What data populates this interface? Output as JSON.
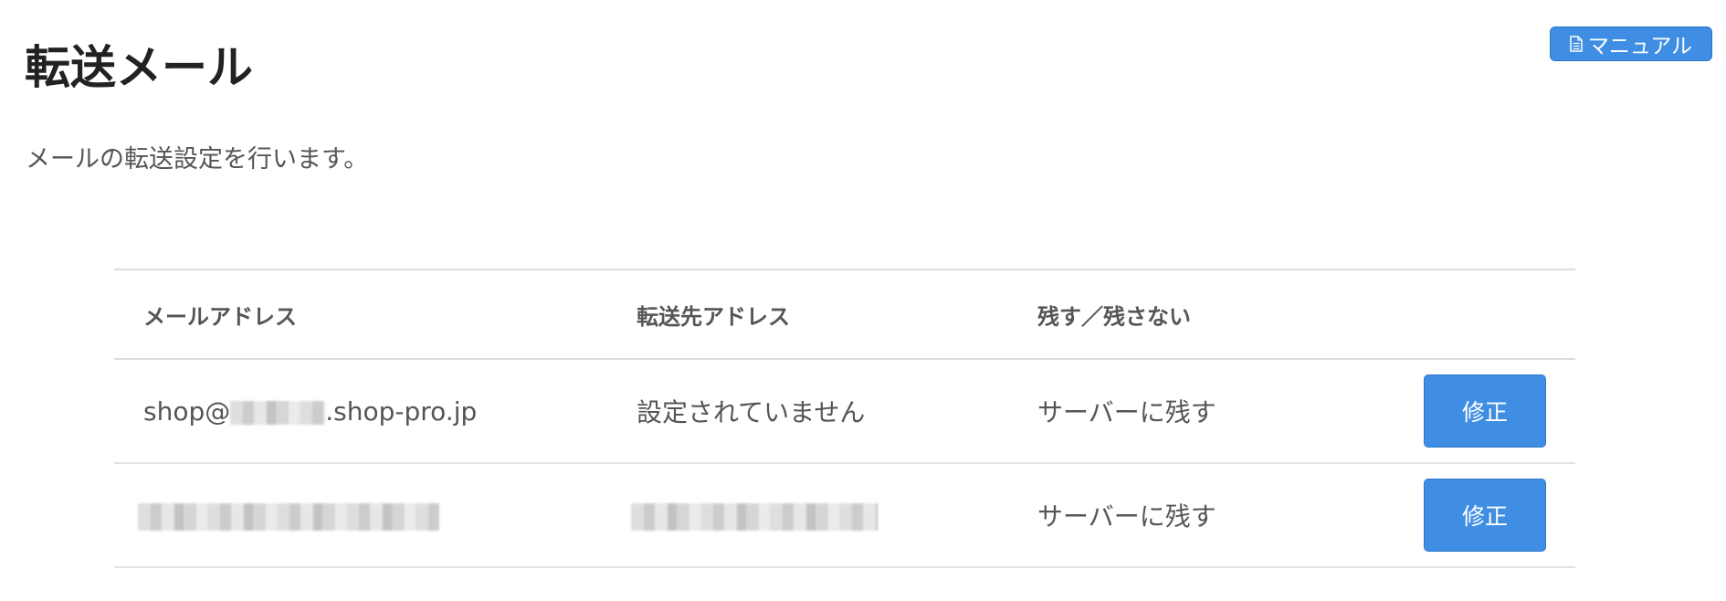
{
  "header": {
    "title": "転送メール",
    "description": "メールの転送設定を行います。",
    "manual_button": {
      "label": "マニュアル",
      "icon": "document-icon"
    }
  },
  "colors": {
    "accent": "#3f8ee4",
    "border": "#dddddd",
    "text": "#555555",
    "title": "#222222"
  },
  "table": {
    "headers": [
      "メールアドレス",
      "転送先アドレス",
      "残す／残さない",
      ""
    ],
    "rows": [
      {
        "mail_address_prefix": "shop@",
        "mail_address_suffix": ".shop-pro.jp",
        "forward_address": "設定されていません",
        "keep": "サーバーに残す",
        "edit_label": "修正"
      },
      {
        "forward_address": "",
        "keep": "サーバーに残す",
        "edit_label": "修正"
      }
    ]
  }
}
